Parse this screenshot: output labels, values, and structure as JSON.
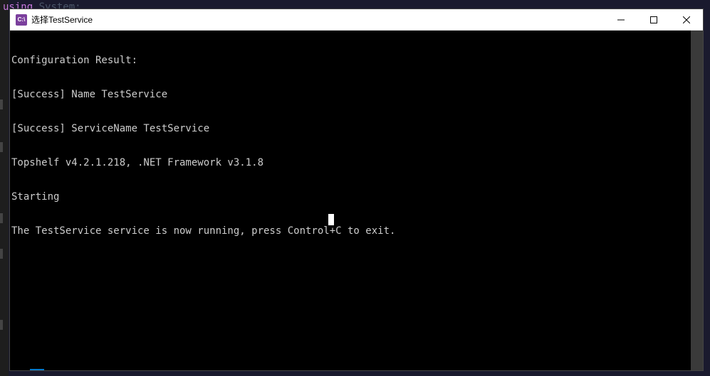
{
  "background": {
    "code_line": "using System;"
  },
  "window": {
    "title": "选择TestService",
    "icon_text": "C:\\"
  },
  "console": {
    "lines": [
      "Configuration Result:",
      "[Success] Name TestService",
      "[Success] ServiceName TestService",
      "Topshelf v4.2.1.218, .NET Framework v3.1.8",
      "Starting",
      "The TestService service is now running, press Control+C to exit."
    ]
  }
}
